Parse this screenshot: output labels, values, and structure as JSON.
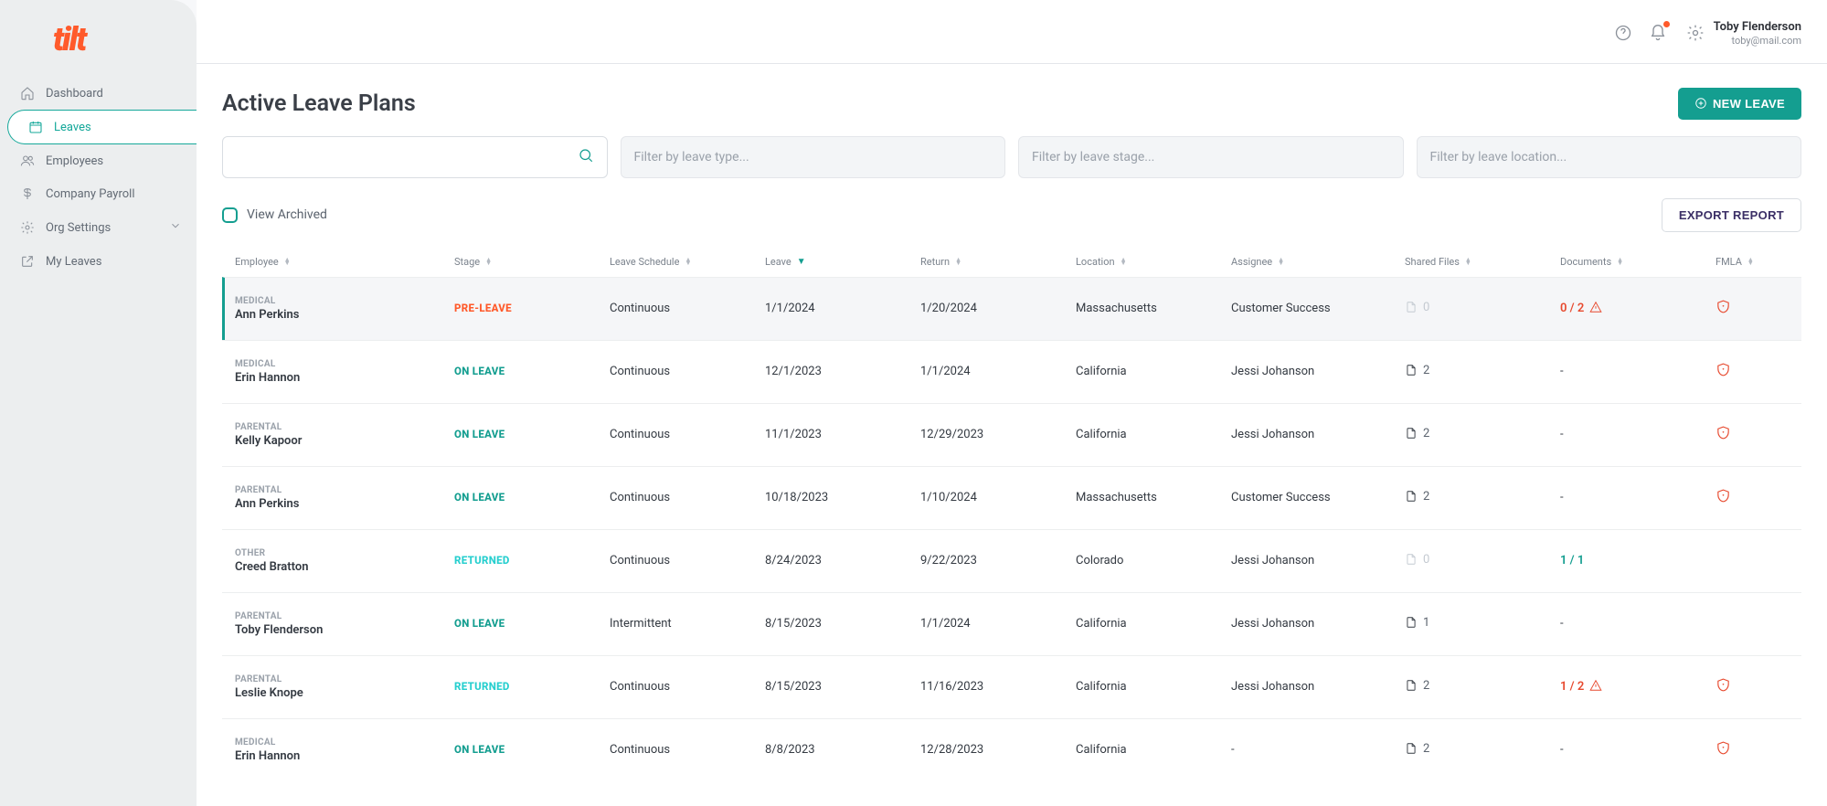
{
  "brand": "tilt",
  "nav": {
    "items": [
      {
        "label": "Dashboard"
      },
      {
        "label": "Leaves"
      },
      {
        "label": "Employees"
      },
      {
        "label": "Company Payroll"
      },
      {
        "label": "Org Settings"
      },
      {
        "label": "My Leaves"
      }
    ]
  },
  "user": {
    "name": "Toby Flenderson",
    "email": "toby@mail.com"
  },
  "page": {
    "title": "Active Leave Plans",
    "new_leave_label": "NEW LEAVE",
    "export_label": "EXPORT REPORT",
    "view_archived_label": "View Archived"
  },
  "filters": {
    "type_placeholder": "Filter by leave type...",
    "stage_placeholder": "Filter by leave stage...",
    "location_placeholder": "Filter by leave location..."
  },
  "table": {
    "headers": {
      "employee": "Employee",
      "stage": "Stage",
      "schedule": "Leave Schedule",
      "leave": "Leave",
      "return": "Return",
      "location": "Location",
      "assignee": "Assignee",
      "shared": "Shared Files",
      "docs": "Documents",
      "fmla": "FMLA"
    },
    "rows": [
      {
        "type": "MEDICAL",
        "name": "Ann Perkins",
        "stage": "PRE-LEAVE",
        "stage_cls": "preleave",
        "schedule": "Continuous",
        "leave": "1/1/2024",
        "return": "1/20/2024",
        "location": "Massachusetts",
        "assignee": "Customer Success",
        "shared": "0",
        "shared_muted": true,
        "docs": "0 / 2",
        "docs_warn": true,
        "fmla": true,
        "active": true
      },
      {
        "type": "MEDICAL",
        "name": "Erin Hannon",
        "stage": "ON LEAVE",
        "stage_cls": "onleave",
        "schedule": "Continuous",
        "leave": "12/1/2023",
        "return": "1/1/2024",
        "location": "California",
        "assignee": "Jessi Johanson",
        "shared": "2",
        "shared_muted": false,
        "docs": "-",
        "docs_warn": false,
        "fmla": true
      },
      {
        "type": "PARENTAL",
        "name": "Kelly Kapoor",
        "stage": "ON LEAVE",
        "stage_cls": "onleave",
        "schedule": "Continuous",
        "leave": "11/1/2023",
        "return": "12/29/2023",
        "location": "California",
        "assignee": "Jessi Johanson",
        "shared": "2",
        "shared_muted": false,
        "docs": "-",
        "docs_warn": false,
        "fmla": true
      },
      {
        "type": "PARENTAL",
        "name": "Ann Perkins",
        "stage": "ON LEAVE",
        "stage_cls": "onleave",
        "schedule": "Continuous",
        "leave": "10/18/2023",
        "return": "1/10/2024",
        "location": "Massachusetts",
        "assignee": "Customer Success",
        "shared": "2",
        "shared_muted": false,
        "docs": "-",
        "docs_warn": false,
        "fmla": true
      },
      {
        "type": "OTHER",
        "name": "Creed Bratton",
        "stage": "RETURNED",
        "stage_cls": "returned",
        "schedule": "Continuous",
        "leave": "8/24/2023",
        "return": "9/22/2023",
        "location": "Colorado",
        "assignee": "Jessi Johanson",
        "shared": "0",
        "shared_muted": true,
        "docs": "1 / 1",
        "docs_warn": false,
        "docs_ok": true,
        "fmla": false
      },
      {
        "type": "PARENTAL",
        "name": "Toby Flenderson",
        "stage": "ON LEAVE",
        "stage_cls": "onleave",
        "schedule": "Intermittent",
        "leave": "8/15/2023",
        "return": "1/1/2024",
        "location": "California",
        "assignee": "Jessi Johanson",
        "shared": "1",
        "shared_muted": false,
        "docs": "-",
        "docs_warn": false,
        "fmla": false
      },
      {
        "type": "PARENTAL",
        "name": "Leslie Knope",
        "stage": "RETURNED",
        "stage_cls": "returned",
        "schedule": "Continuous",
        "leave": "8/15/2023",
        "return": "11/16/2023",
        "location": "California",
        "assignee": "Jessi Johanson",
        "shared": "2",
        "shared_muted": false,
        "docs": "1 / 2",
        "docs_warn": true,
        "fmla": true
      },
      {
        "type": "MEDICAL",
        "name": "Erin Hannon",
        "stage": "ON LEAVE",
        "stage_cls": "onleave",
        "schedule": "Continuous",
        "leave": "8/8/2023",
        "return": "12/28/2023",
        "location": "California",
        "assignee": "-",
        "shared": "2",
        "shared_muted": false,
        "docs": "-",
        "docs_warn": false,
        "fmla": true
      }
    ]
  }
}
